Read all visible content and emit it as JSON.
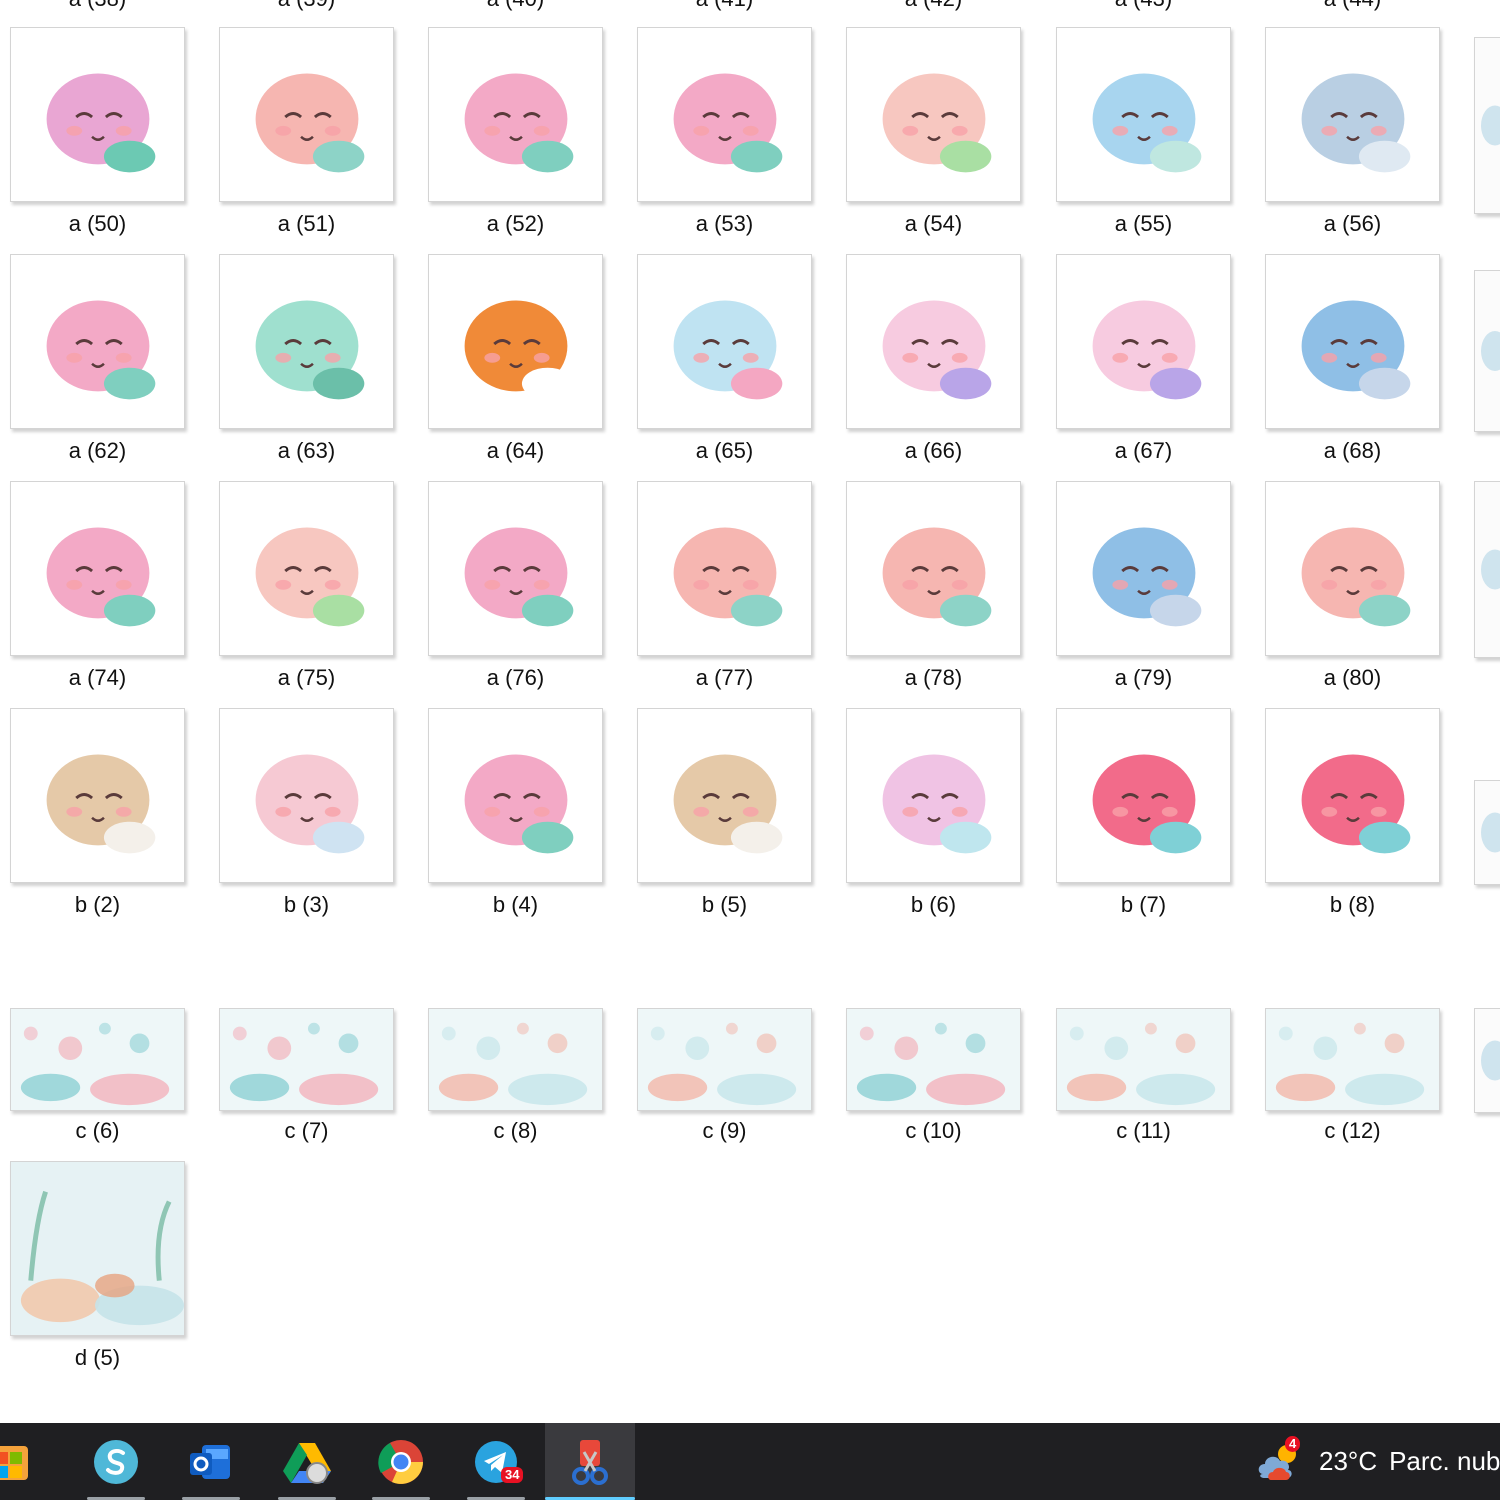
{
  "header_partial": [
    "a (38)",
    "a (39)",
    "a (40)",
    "a (41)",
    "a (42)",
    "a (43)",
    "a (44)"
  ],
  "rows": [
    {
      "labels": [
        "a (50)",
        "a (51)",
        "a (52)",
        "a (53)",
        "a (54)",
        "a (55)",
        "a (56)"
      ],
      "icons": [
        "fish-thumbnail",
        "seahorse-thumbnail",
        "mermaid-thumbnail",
        "mermaid-thumbnail",
        "pufferfish-thumbnail",
        "shark-thumbnail",
        "whale-thumbnail"
      ]
    },
    {
      "labels": [
        "a (62)",
        "a (63)",
        "a (64)",
        "a (65)",
        "a (66)",
        "a (67)",
        "a (68)"
      ],
      "icons": [
        "mermaid-thumbnail",
        "turtle-thumbnail",
        "clownfish-thumbnail",
        "jellyfish-thumbnail",
        "anglerfish-thumbnail",
        "anglerfish-thumbnail",
        "dolphin-thumbnail"
      ]
    },
    {
      "labels": [
        "a (74)",
        "a (75)",
        "a (76)",
        "a (77)",
        "a (78)",
        "a (79)",
        "a (80)"
      ],
      "icons": [
        "mermaid-thumbnail",
        "pufferfish-thumbnail",
        "mermaid-thumbnail",
        "seahorse-thumbnail",
        "seahorse-thumbnail",
        "dolphin-thumbnail",
        "seahorse-thumbnail"
      ]
    },
    {
      "labels": [
        "b (2)",
        "b (3)",
        "b (4)",
        "b (5)",
        "b (6)",
        "b (7)",
        "b (8)"
      ],
      "icons": [
        "pearl-shell-thumbnail",
        "conch-shell-thumbnail",
        "mermaid-thumbnail",
        "pearl-shell-thumbnail",
        "snail-thumbnail",
        "coral-thumbnail",
        "coral-thumbnail"
      ]
    },
    {
      "labels": [
        "c (6)",
        "c (7)",
        "c (8)",
        "c (9)",
        "c (10)",
        "c (11)",
        "c (12)"
      ],
      "icons": [
        "sea-pattern-thumbnail",
        "sea-pattern-thumbnail",
        "seascape-thumbnail",
        "seascape-thumbnail",
        "sea-pattern-thumbnail",
        "seascape-thumbnail",
        "seascape-thumbnail"
      ]
    },
    {
      "labels": [
        "d (5)"
      ],
      "icons": [
        "underwater-scene-thumbnail"
      ]
    }
  ],
  "taskbar": {
    "apps": [
      "start-icon",
      "sketch-app-icon",
      "outlook-icon",
      "google-drive-icon",
      "chrome-icon",
      "telegram-icon",
      "snipping-tool-icon"
    ],
    "telegram_badge": "34",
    "weather_badge": "4",
    "temperature": "23°C",
    "weather_text": "Parc. nub"
  },
  "colors": {
    "taskbar_bg": "#1f1f22",
    "active_accent": "#60cdff",
    "badge": "#e81123"
  }
}
